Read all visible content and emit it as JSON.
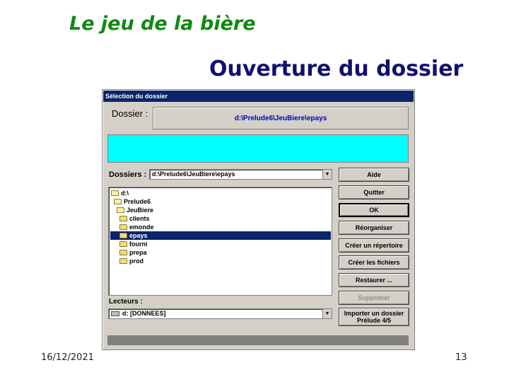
{
  "slide": {
    "title": "Le jeu de la bière",
    "subtitle": "Ouverture du dossier",
    "date": "16/12/2021",
    "page": "13"
  },
  "dialog": {
    "title": "Sélection du dossier",
    "folder_label": "Dossier :",
    "folder_path": "d:\\Prelude6\\JeuBiere\\epays",
    "folders_label": "Dossiers :",
    "folders_combo_value": "d:\\Prelude6\\JeuBiere\\epays",
    "tree": [
      {
        "label": "d:\\",
        "icon": "folder-open-icon",
        "selected": false
      },
      {
        "label": "Prelude6",
        "icon": "folder-open-icon",
        "selected": false
      },
      {
        "label": "JeuBiere",
        "icon": "folder-open-icon",
        "selected": false
      },
      {
        "label": "clients",
        "icon": "folder-icon",
        "selected": false
      },
      {
        "label": "emonde",
        "icon": "folder-icon",
        "selected": false
      },
      {
        "label": "epays",
        "icon": "folder-icon",
        "selected": true
      },
      {
        "label": "fourni",
        "icon": "folder-icon",
        "selected": false
      },
      {
        "label": "prepa",
        "icon": "folder-icon",
        "selected": false
      },
      {
        "label": "prod",
        "icon": "folder-icon",
        "selected": false
      }
    ],
    "drives_label": "Lecteurs :",
    "drive_value": "d: [DONNEES]",
    "buttons": {
      "help": "Aide",
      "quit": "Quitter",
      "ok": "OK",
      "reorganize": "Réorganiser",
      "create_dir": "Créer un répertoire",
      "create_files": "Créer les fichiers",
      "restore": "Restaurer ...",
      "delete": "Supprimer",
      "import_line1": "Importer un dossier",
      "import_line2": "Prélude 4/5"
    }
  }
}
